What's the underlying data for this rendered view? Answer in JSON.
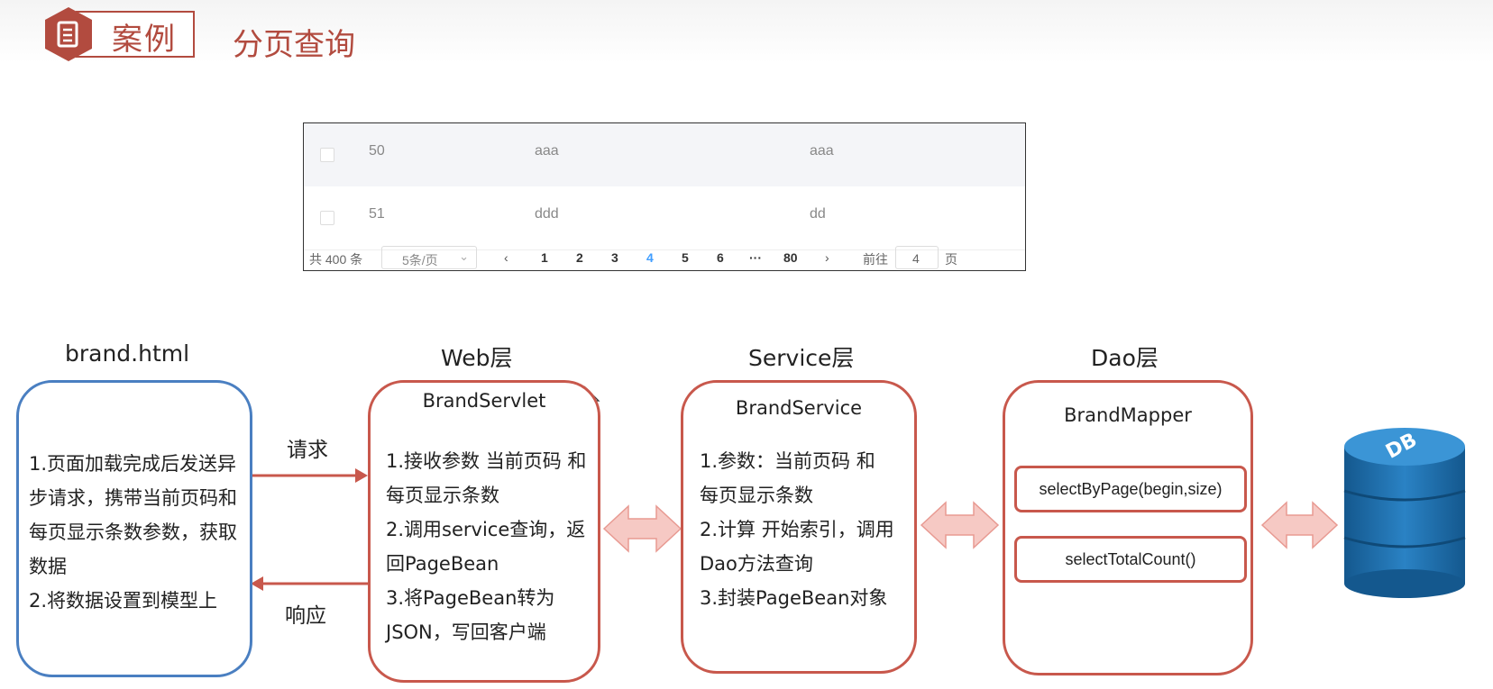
{
  "header": {
    "badge_label": "案例",
    "title": "分页查询"
  },
  "table": {
    "rows": [
      {
        "id": "50",
        "name": "aaa",
        "company": "aaa"
      },
      {
        "id": "51",
        "name": "ddd",
        "company": "dd"
      }
    ],
    "pager": {
      "total": "共 400 条",
      "page_size": "5条/页",
      "pages": [
        "1",
        "2",
        "3",
        "4",
        "5",
        "6",
        "···",
        "80"
      ],
      "current_page": "4",
      "goto_label": "前往",
      "goto_value": "4",
      "page_unit": "页"
    }
  },
  "diagram": {
    "layers": [
      {
        "title": "brand.html"
      },
      {
        "title": "Web层",
        "box_title": "BrandServlet"
      },
      {
        "title": "Service层",
        "box_title": "BrandService"
      },
      {
        "title": "Dao层",
        "box_title": "BrandMapper"
      }
    ],
    "frontend_steps": [
      "1.页面加载完成后发送异",
      "步请求，携带当前页码和",
      "每页显示条数参数，获取",
      "数据",
      "2.将数据设置到模型上"
    ],
    "web_steps": [
      "1.接收参数 当前页码 和",
      "每页显示条数",
      "2.调用service查询，返",
      "回PageBean",
      "3.将PageBean转为",
      "JSON，写回客户端"
    ],
    "service_steps": [
      "1.参数：当前页码 和",
      "每页显示条数",
      "2.计算 开始索引，调用",
      "Dao方法查询",
      "3.封装PageBean对象"
    ],
    "dao_methods": [
      "selectByPage(begin,size)",
      "selectTotalCount()"
    ],
    "request_label": "请求",
    "response_label": "响应",
    "db_label": "DB"
  },
  "colors": {
    "accent": "#b24b3f",
    "box_red": "#c8584c",
    "box_blue": "#4a7fc1",
    "arrow_fill": "#f6c9c4",
    "db_blue": "#1f6fae",
    "pager_active": "#409eff"
  },
  "icons": [
    "document-icon",
    "db-cylinder-icon",
    "mouse-cursor-icon"
  ]
}
